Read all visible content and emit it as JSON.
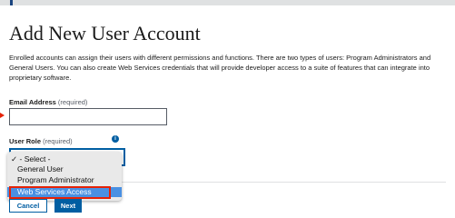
{
  "header": {
    "title": "Add New User Account",
    "intro": "Enrolled accounts can assign their users with different permissions and functions. There are two types of users: Program Administrators and General Users. You can also create Web Services credentials that will provide developer access to a suite of features that can integrate into proprietary software."
  },
  "form": {
    "email": {
      "label": "Email Address",
      "required": "(required)",
      "value": ""
    },
    "role": {
      "label": "User Role",
      "required": "(required)",
      "info_icon": "info-icon",
      "selected": "- Select -",
      "options": [
        "- Select -",
        "General User",
        "Program Administrator",
        "Web Services Access"
      ]
    }
  },
  "dropdown": {
    "check_mark": "✓",
    "highlighted": "Web Services Access"
  },
  "buttons": {
    "cancel": "Cancel",
    "next": "Next"
  },
  "colors": {
    "primary": "#005ea2",
    "highlight": "#e52207",
    "dropdown_selection": "#4a90e2"
  }
}
